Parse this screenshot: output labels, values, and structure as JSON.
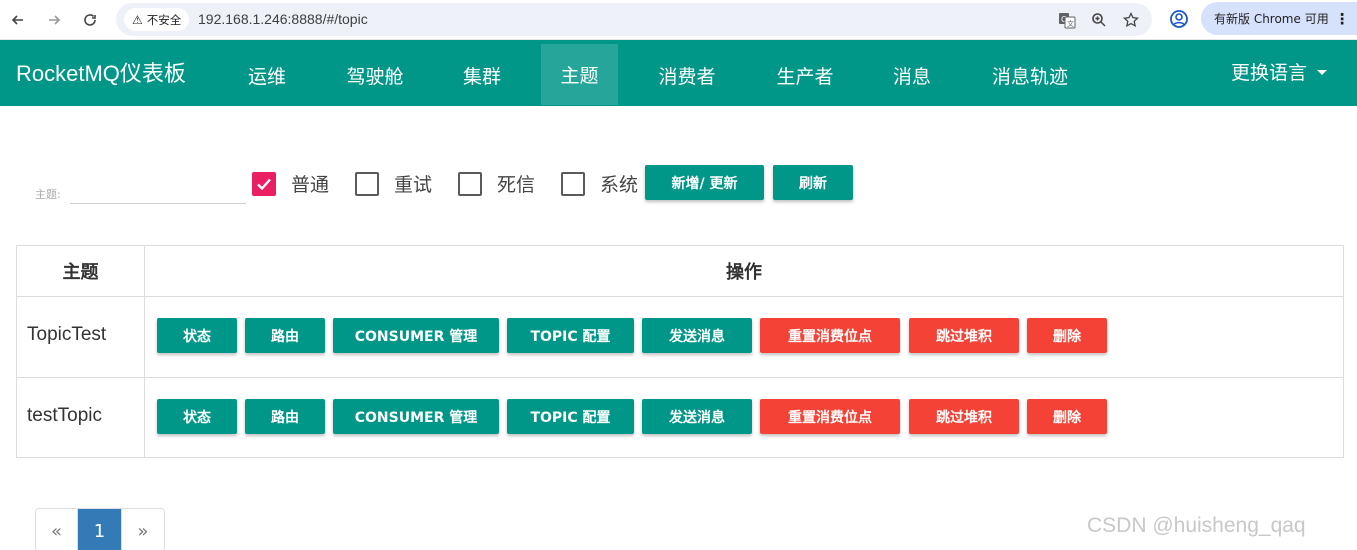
{
  "browser": {
    "security_label": "不安全",
    "url": "192.168.1.246:8888/#/topic",
    "update_label": "有新版 Chrome 可用"
  },
  "navbar": {
    "brand": "RocketMQ仪表板",
    "items": [
      {
        "label": "运维"
      },
      {
        "label": "驾驶舱"
      },
      {
        "label": "集群"
      },
      {
        "label": "主题",
        "active": true
      },
      {
        "label": "消费者"
      },
      {
        "label": "生产者"
      },
      {
        "label": "消息"
      },
      {
        "label": "消息轨迹"
      }
    ],
    "language_label": "更换语言",
    "color": "#009688"
  },
  "filter": {
    "topic_label": "主题:",
    "topic_value": "",
    "checkboxes": [
      {
        "label": "普通",
        "checked": true
      },
      {
        "label": "重试",
        "checked": false
      },
      {
        "label": "死信",
        "checked": false
      },
      {
        "label": "系统",
        "checked": false
      }
    ],
    "add_update_label": "新增/ 更新",
    "refresh_label": "刷新"
  },
  "table": {
    "headers": [
      "主题",
      "操作"
    ],
    "action_labels": {
      "status": "状态",
      "route": "路由",
      "consumer": "CONSUMER 管理",
      "topic_config": "TOPIC 配置",
      "send": "发送消息",
      "reset_offset": "重置消费位点",
      "skip_backlog": "跳过堆积",
      "delete": "删除"
    },
    "rows": [
      {
        "topic": "TopicTest"
      },
      {
        "topic": "testTopic"
      }
    ]
  },
  "pagination": {
    "prev": "«",
    "current": "1",
    "next": "»"
  },
  "watermark": "CSDN @huisheng_qaq",
  "colors": {
    "primary": "#009688",
    "danger": "#f44336",
    "checkbox_checked": "#e91e63",
    "page_active": "#337ab7"
  }
}
